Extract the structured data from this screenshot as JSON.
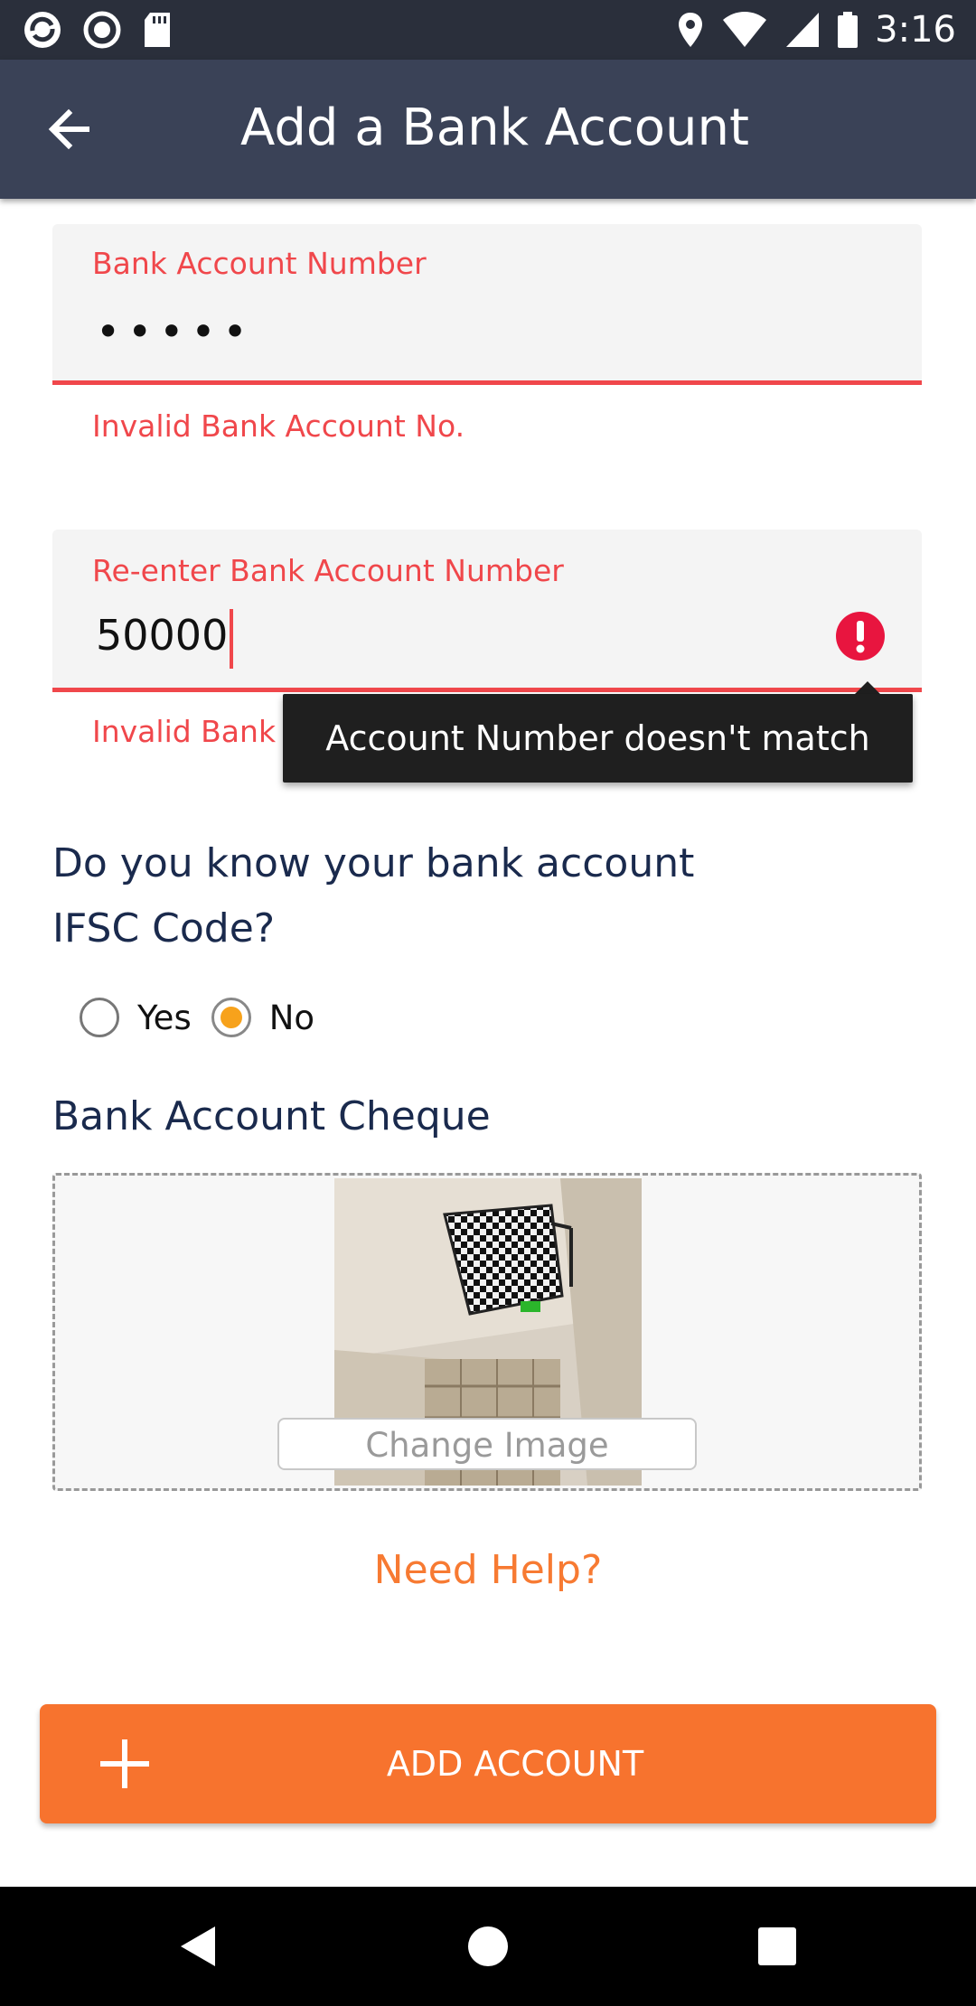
{
  "status_bar": {
    "time": "3:16"
  },
  "app_bar": {
    "title": "Add a Bank Account"
  },
  "account_field": {
    "label": "Bank Account Number",
    "masked_value": "•••••",
    "error": "Invalid Bank Account No."
  },
  "reenter_field": {
    "label": "Re-enter Bank Account Number",
    "value": "50000",
    "error": "Invalid Bank Account No.",
    "tooltip": "Account Number doesn't match"
  },
  "ifsc_question": {
    "line1": "Do you know your bank account",
    "line2": "IFSC Code?",
    "options": [
      {
        "label": "Yes",
        "selected": false
      },
      {
        "label": "No",
        "selected": true
      }
    ]
  },
  "cheque": {
    "title": "Bank Account Cheque",
    "change_label": "Change Image"
  },
  "help_link": "Need Help?",
  "add_button": {
    "label": "ADD ACCOUNT",
    "icon": "plus-icon"
  },
  "colors": {
    "error": "#f0474b",
    "accent": "#f7732e",
    "appbar": "#3a4257",
    "radio_selected": "#f7a21b"
  }
}
